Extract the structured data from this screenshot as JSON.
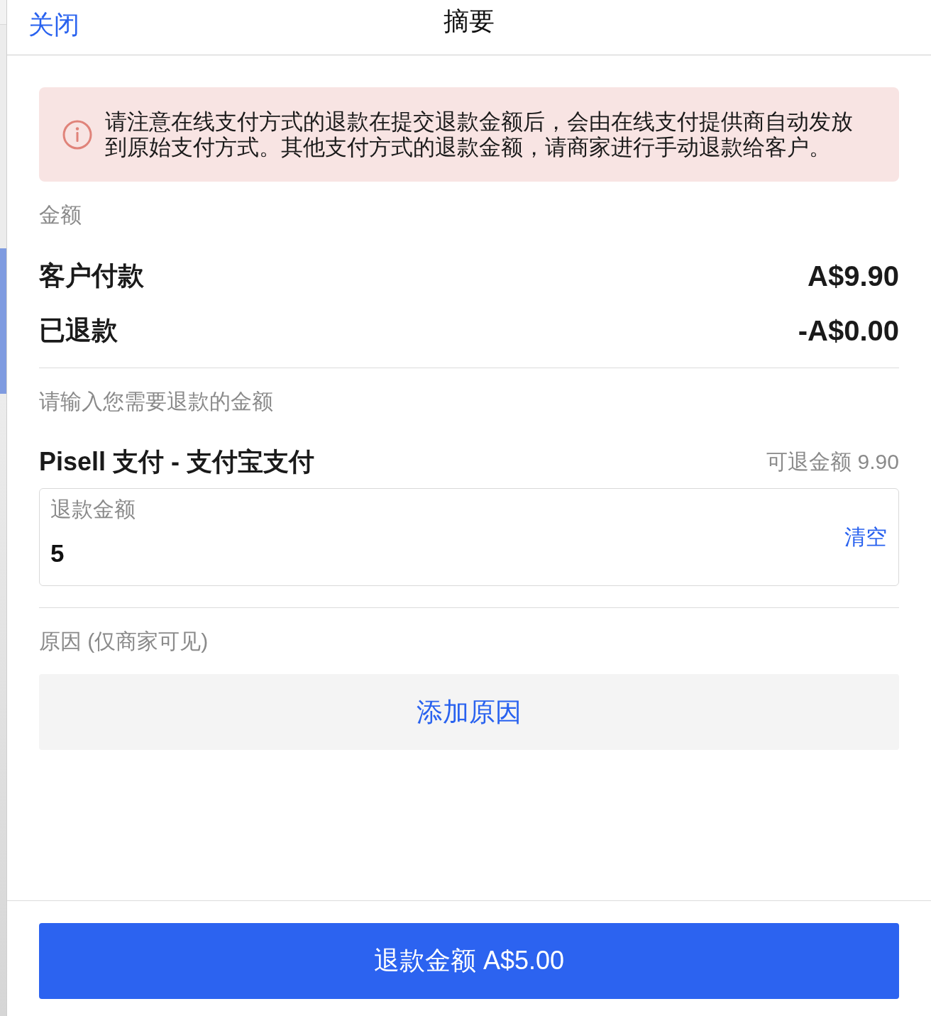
{
  "header": {
    "close": "关闭",
    "title": "摘要"
  },
  "notice": {
    "text": "请注意在线支付方式的退款在提交退款金额后，会由在线支付提供商自动发放到原始支付方式。其他支付方式的退款金额，请商家进行手动退款给客户。"
  },
  "amount_section": {
    "label": "金额",
    "rows": [
      {
        "label": "客户付款",
        "value": "A$9.90"
      },
      {
        "label": "已退款",
        "value": "-A$0.00"
      }
    ]
  },
  "refund_section": {
    "label": "请输入您需要退款的金额",
    "method": "Pisell 支付 - 支付宝支付",
    "available": "可退金额 9.90",
    "field": {
      "label": "退款金额",
      "value": "5",
      "clear": "清空"
    }
  },
  "reason_section": {
    "label": "原因 (仅商家可见)",
    "button": "添加原因"
  },
  "submit_button": "退款金额 A$5.00"
}
